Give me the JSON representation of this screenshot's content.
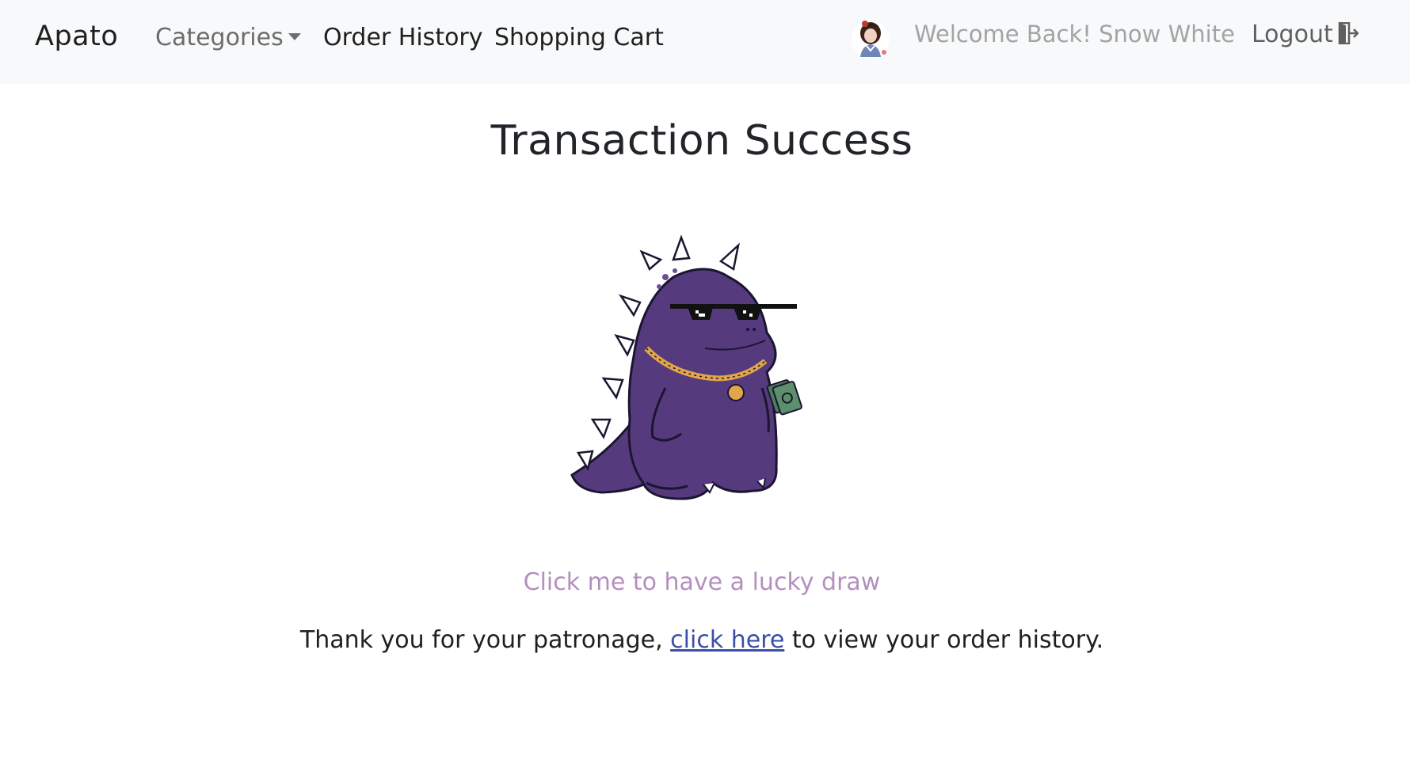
{
  "navbar": {
    "brand": "Apato",
    "categories_label": "Categories",
    "order_history_label": "Order History",
    "shopping_cart_label": "Shopping Cart",
    "welcome_text": "Welcome Back! Snow White",
    "logout_label": "Logout"
  },
  "main": {
    "title": "Transaction Success",
    "lucky_draw_label": "Click me to have a lucky draw",
    "thanks_prefix": "Thank you for your patronage,",
    "thanks_link": "click here",
    "thanks_suffix": "to view your order history."
  },
  "icons": {
    "categories_caret": "chevron-down-icon",
    "logout": "logout-door-icon",
    "avatar": "user-avatar",
    "mascot": "purple-dinosaur-sunglasses-illustration"
  },
  "colors": {
    "navbar_bg": "#f8f9fa",
    "lucky_draw": "#b48fbf",
    "link": "#3b4fa8",
    "dino_body": "#553a7e"
  }
}
